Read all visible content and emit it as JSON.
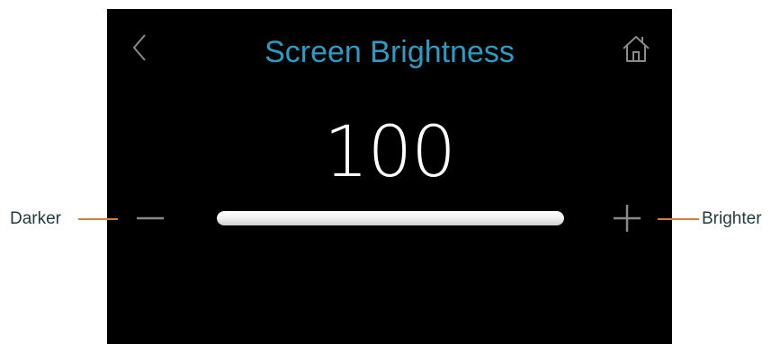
{
  "screen": {
    "title": "Screen Brightness",
    "value": "100",
    "brightness_fraction": 1.0,
    "colors": {
      "background": "#000000",
      "title": "#2b9cc4",
      "value": "#ffffff",
      "slider_fill": "#f0f0f0",
      "controls": "#8a8a8a"
    },
    "icons": {
      "back": "chevron-left-icon",
      "home": "home-icon",
      "decrease": "minus-icon",
      "increase": "plus-icon"
    }
  },
  "callouts": {
    "left_label": "Darker",
    "right_label": "Brighter",
    "leader_color": "#e07a2e"
  }
}
